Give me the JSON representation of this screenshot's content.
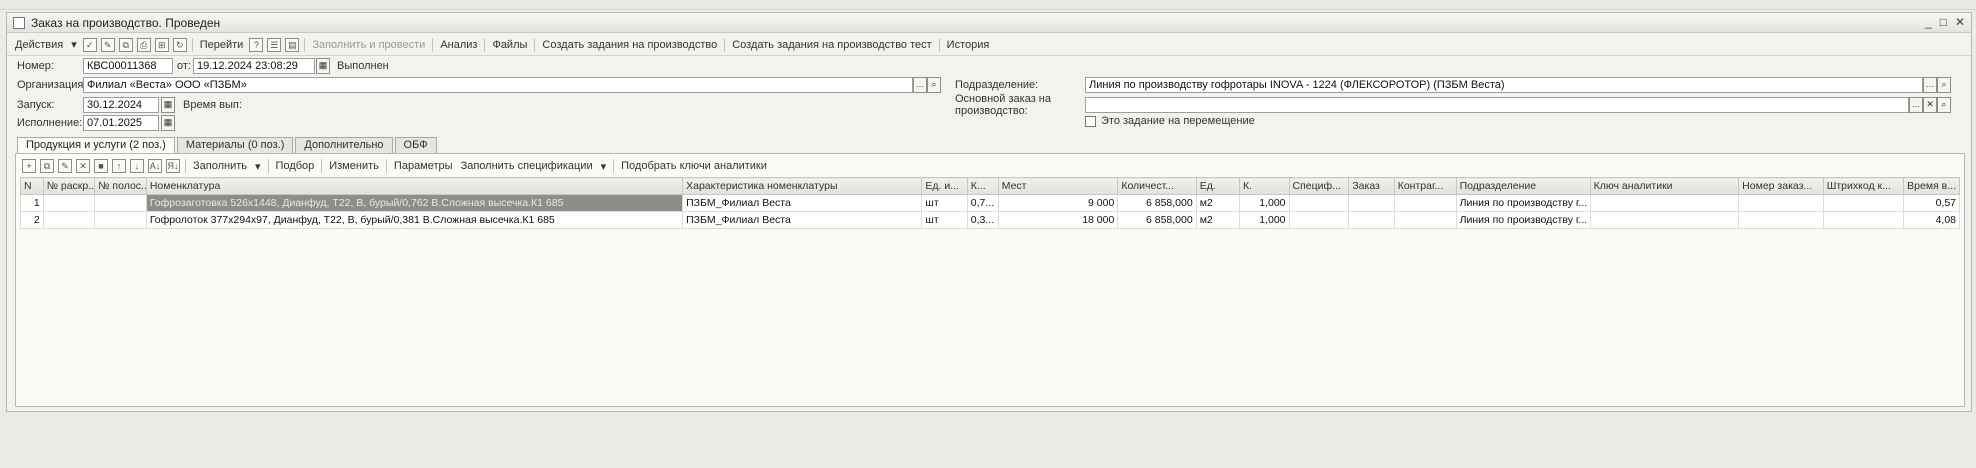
{
  "window": {
    "title": "Заказ на производство. Проведен",
    "controls": [
      "_",
      "□",
      "✕"
    ]
  },
  "toolbar": {
    "actions_label": "Действия",
    "goto_label": "Перейти",
    "fill_and_post_label": "Заполнить и провести",
    "analysis_label": "Анализ",
    "files_label": "Файлы",
    "create_tasks_label": "Создать задания на производство",
    "create_tasks_test_label": "Создать задания на производство тест",
    "history_label": "История"
  },
  "header": {
    "number_label": "Номер:",
    "number_value": "КВС00011368",
    "from_label": "от:",
    "date_value": "19.12.2024 23:08:29",
    "status": "Выполнен",
    "org_label": "Организация:",
    "org_value": "Филиал «Веста» ООО «ПЗБМ»",
    "launch_label": "Запуск:",
    "launch_value": "30.12.2024",
    "exec_time_label": "Время вып:",
    "execution_label": "Исполнение:",
    "execution_value": "07.01.2025",
    "division_label": "Подразделение:",
    "division_value": "Линия по производству гофротары INOVA - 1224 (ФЛЕКСОРОТОР) (ПЗБМ Веста)",
    "main_order_label": "Основной заказ на производство:",
    "main_order_value": "",
    "move_task_label": "Это задание на перемещение"
  },
  "tabs": [
    {
      "label": "Продукция и услуги (2 поз.)"
    },
    {
      "label": "Материалы (0 поз.)"
    },
    {
      "label": "Дополнительно"
    },
    {
      "label": "ОБФ"
    }
  ],
  "panel_toolbar": {
    "fill_label": "Заполнить",
    "selection_label": "Подбор",
    "change_label": "Изменить",
    "params_label": "Параметры",
    "fill_specs_label": "Заполнить спецификации",
    "pick_keys_label": "Подобрать ключи аналитики"
  },
  "table": {
    "columns": [
      "N",
      "№ раскр...",
      "№ полос...",
      "Номенклатура",
      "Характеристика номенклатуры",
      "Ед. и...",
      "К...",
      "Мест",
      "Количест...",
      "Ед.",
      "К.",
      "Специф...",
      "Заказ",
      "Контраг...",
      "Подразделение",
      "Ключ аналитики",
      "Номер заказ...",
      "Штрихкод к...",
      "Время в..."
    ],
    "rows": [
      {
        "n": "1",
        "raskr": "",
        "polos": "",
        "nomen": "Гофрозаготовка 526х1448, Дианфуд, Т22, В, бурый/0,762 В.Сложная высечка.К1 685",
        "char": "ПЗБМ_Филиал Веста",
        "ed_m": "шт",
        "k": "0,7...",
        "mest": "9 000",
        "qty": "6 858,000",
        "ed": "м2",
        "k2": "1,000",
        "spec": "",
        "order": "",
        "contr": "",
        "div": "Линия по производству г...",
        "key": "",
        "ordnum": "",
        "barcode": "",
        "time": "0,57"
      },
      {
        "n": "2",
        "raskr": "",
        "polos": "",
        "nomen": "Гофролоток 377х294х97, Дианфуд, Т22, В, бурый/0,381 В.Сложная высечка.К1 685",
        "char": "ПЗБМ_Филиал Веста",
        "ed_m": "шт",
        "k": "0,3...",
        "mest": "18 000",
        "qty": "6 858,000",
        "ed": "м2",
        "k2": "1,000",
        "spec": "",
        "order": "",
        "contr": "",
        "div": "Линия по производству г...",
        "key": "",
        "ordnum": "",
        "barcode": "",
        "time": "4,08"
      }
    ]
  }
}
